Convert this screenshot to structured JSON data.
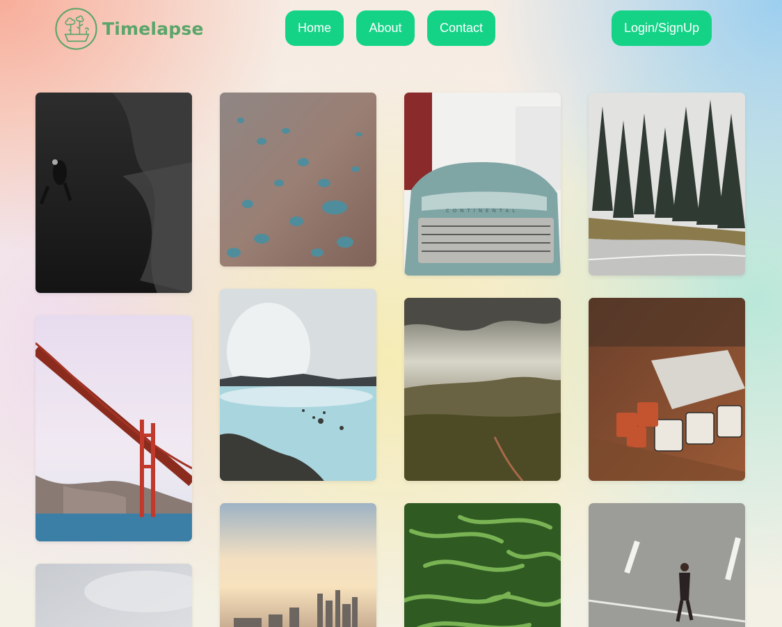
{
  "brand": {
    "name": "Timelapse",
    "logo_icon": "tree-pot-icon",
    "color": "#5aa56a"
  },
  "nav": {
    "home": "Home",
    "about": "About",
    "contact": "Contact",
    "login": "Login/SignUp",
    "accent": "#14d387"
  },
  "gallery": [
    {
      "subject": "scuba-diver-dark-underwater"
    },
    {
      "subject": "water-droplets"
    },
    {
      "subject": "vintage-car-continental"
    },
    {
      "subject": "foggy-forest-road"
    },
    {
      "subject": "golden-gate-bridge"
    },
    {
      "subject": "blue-lagoon-hot-spring"
    },
    {
      "subject": "valley-cloudy-sky"
    },
    {
      "subject": "enamel-mugs-on-table"
    },
    {
      "subject": "misty-sky"
    },
    {
      "subject": "city-skyline-sunset"
    },
    {
      "subject": "green-beans"
    },
    {
      "subject": "man-walking-on-street"
    }
  ]
}
